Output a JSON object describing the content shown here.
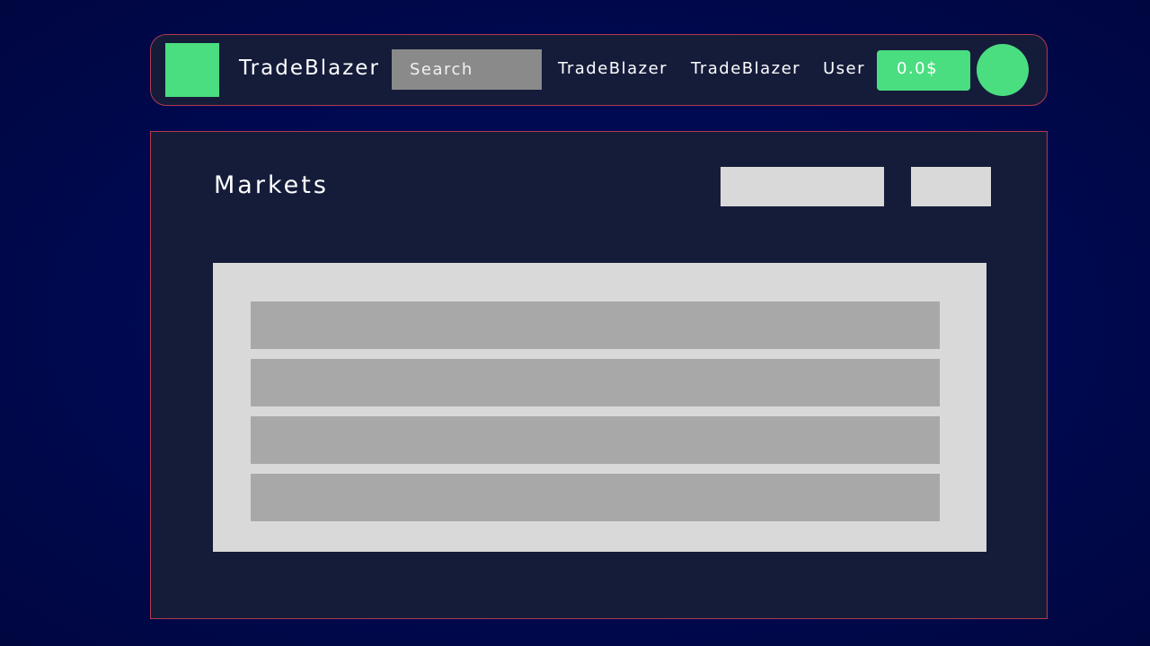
{
  "header": {
    "logo_icon": "green-square-logo",
    "brand": "TradeBlazer",
    "search_placeholder": "Search",
    "nav": [
      "TradeBlazer",
      "TradeBlazer",
      "User"
    ],
    "balance": "0.0$",
    "avatar_icon": "user-avatar-circle"
  },
  "main": {
    "title": "Markets",
    "market_rows": 4
  },
  "colors": {
    "accent": "#4ade80",
    "panel": "#151c3a",
    "border": "#b13a4e",
    "background": "#000d5f",
    "placeholder_light": "#d9d9d9",
    "placeholder_dark": "#a8a8a8"
  }
}
